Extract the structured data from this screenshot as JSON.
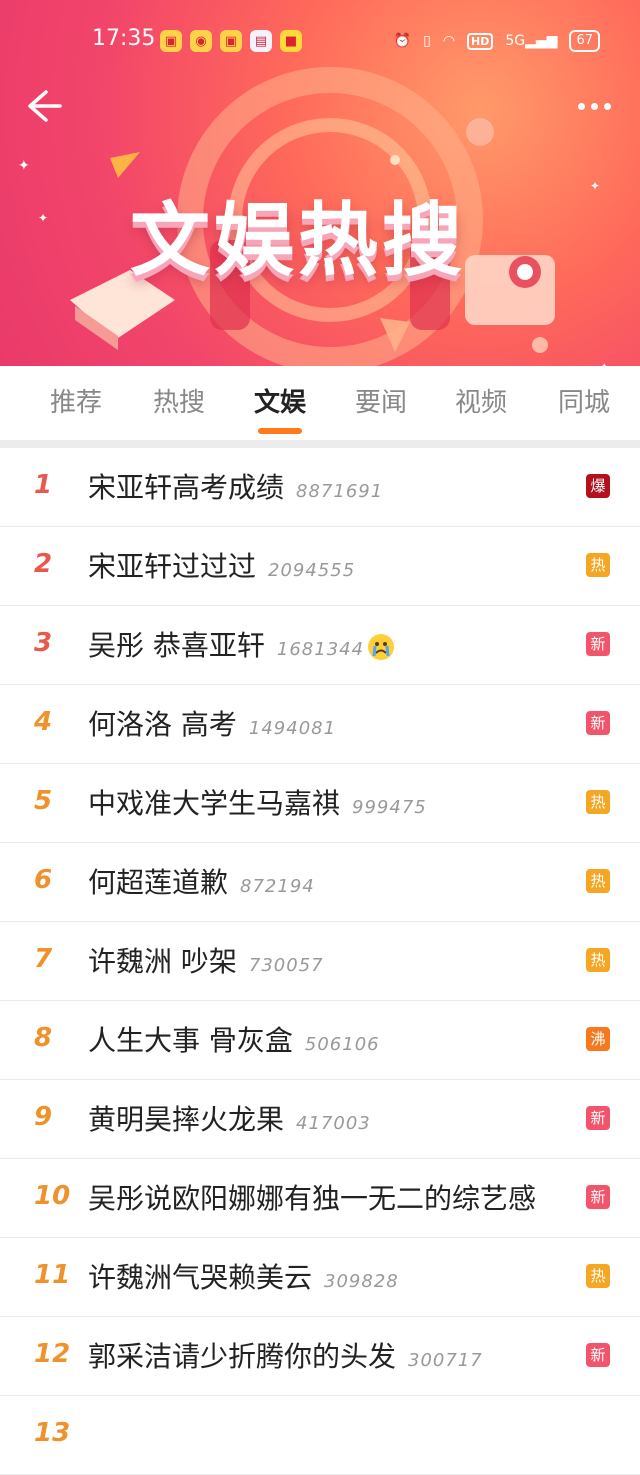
{
  "status_bar": {
    "time": "17:35",
    "battery": "67",
    "hd": "HD",
    "network": "5G"
  },
  "header": {
    "title": "文娱热搜"
  },
  "tabs": [
    {
      "label": "推荐"
    },
    {
      "label": "热搜"
    },
    {
      "label": "文娱"
    },
    {
      "label": "要闻"
    },
    {
      "label": "视频"
    },
    {
      "label": "同城"
    }
  ],
  "active_tab": "文娱",
  "badge_colors": {
    "爆": "#b2111d",
    "热": "#f5a623",
    "新": "#f2556b",
    "沸": "#f57a1f"
  },
  "rank_colors": {
    "top": "#e8584d",
    "other": "#f0922c"
  },
  "items": [
    {
      "rank": "1",
      "title": "宋亚轩高考成绩",
      "count": "8871691",
      "badge": "爆"
    },
    {
      "rank": "2",
      "title": "宋亚轩过过过",
      "count": "2094555",
      "badge": "热"
    },
    {
      "rank": "3",
      "title": "吴彤 恭喜亚轩",
      "count": "1681344",
      "badge": "新",
      "emoji": "crying-emoji"
    },
    {
      "rank": "4",
      "title": "何洛洛 高考",
      "count": "1494081",
      "badge": "新"
    },
    {
      "rank": "5",
      "title": "中戏准大学生马嘉祺",
      "count": "999475",
      "badge": "热"
    },
    {
      "rank": "6",
      "title": "何超莲道歉",
      "count": "872194",
      "badge": "热"
    },
    {
      "rank": "7",
      "title": "许魏洲 吵架",
      "count": "730057",
      "badge": "热"
    },
    {
      "rank": "8",
      "title": "人生大事 骨灰盒",
      "count": "506106",
      "badge": "沸"
    },
    {
      "rank": "9",
      "title": "黄明昊摔火龙果",
      "count": "417003",
      "badge": "新"
    },
    {
      "rank": "10",
      "title": "吴彤说欧阳娜娜有独一无二的综艺感",
      "count": "",
      "badge": "新"
    },
    {
      "rank": "11",
      "title": "许魏洲气哭赖美云",
      "count": "309828",
      "badge": "热"
    },
    {
      "rank": "12",
      "title": "郭采洁请少折腾你的头发",
      "count": "300717",
      "badge": "新"
    },
    {
      "rank": "13",
      "title": "",
      "count": "",
      "badge": ""
    }
  ]
}
